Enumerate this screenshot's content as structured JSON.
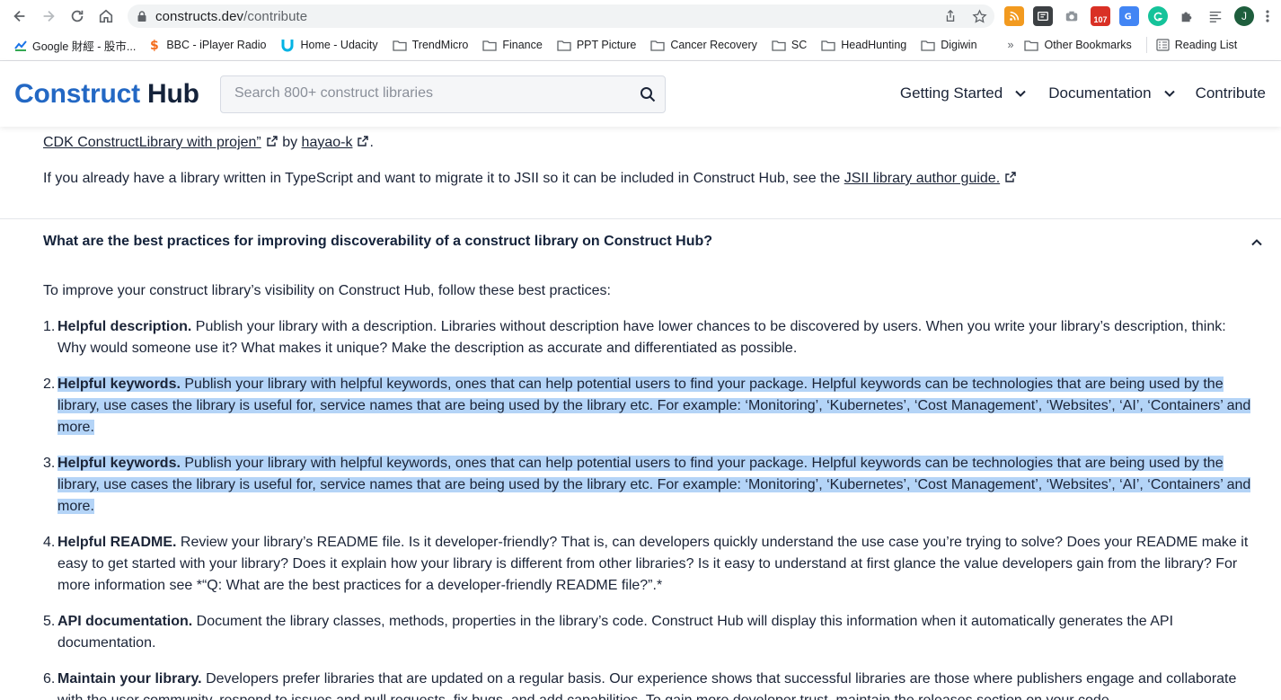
{
  "browser": {
    "url_host": "constructs.dev",
    "url_path": "/contribute",
    "ext_badge": "107",
    "avatar_letter": "J",
    "bookmarks": [
      {
        "label": "Google 財經 - 股市...",
        "icon": "google-finance-icon"
      },
      {
        "label": "BBC - iPlayer Radio",
        "icon": "bbc-icon"
      },
      {
        "label": "Home - Udacity",
        "icon": "udacity-icon"
      },
      {
        "label": "TrendMicro",
        "icon": "folder-icon"
      },
      {
        "label": "Finance",
        "icon": "folder-icon"
      },
      {
        "label": "PPT Picture",
        "icon": "folder-icon"
      },
      {
        "label": "Cancer Recovery",
        "icon": "folder-icon"
      },
      {
        "label": "SC",
        "icon": "folder-icon"
      },
      {
        "label": "HeadHunting",
        "icon": "folder-icon"
      },
      {
        "label": "Digiwin",
        "icon": "folder-icon"
      }
    ],
    "overflow_label": "»",
    "other_bookmarks": "Other Bookmarks",
    "reading_list": "Reading List"
  },
  "header": {
    "logo_construct": "Construct",
    "logo_hub": "Hub",
    "search_placeholder": "Search 800+ construct libraries",
    "nav": {
      "getting_started": "Getting Started",
      "documentation": "Documentation",
      "contribute": "Contribute"
    }
  },
  "content": {
    "top_link_text": "CDK ConstructLibrary with projen”",
    "top_by": " by ",
    "top_author": "hayao-k",
    "migrate_text": "If you already have a library written in TypeScript and want to migrate it to JSII so it can be included in Construct Hub, see the ",
    "migrate_link": "JSII library author guide.",
    "faq_question": "What are the best practices for improving discoverability of a construct library on Construct Hub?",
    "intro": "To improve your construct library’s visibility on Construct Hub, follow these best practices:",
    "practices": [
      {
        "title": "Helpful description.",
        "body": " Publish your library with a description. Libraries without description have lower chances to be discovered by users. When you write your library’s description, think: Why would someone use it? What makes it unique? Make the description as accurate and differentiated as possible."
      },
      {
        "title": "Helpful keywords.",
        "body": " Publish your library with helpful keywords, ones that can help potential users to find your package. Helpful keywords can be technologies that are being used by the library, use cases the library is useful for, service names that are being used by the library etc. For example: ‘Monitoring’, ‘Kubernetes’, ‘Cost Management’, ‘Websites’, ‘AI’, ‘Containers’ and more."
      },
      {
        "title": "Helpful keywords.",
        "body": " Publish your library with helpful keywords, ones that can help potential users to find your package. Helpful keywords can be technologies that are being used by the library, use cases the library is useful for, service names that are being used by the library etc. For example: ‘Monitoring’, ‘Kubernetes’, ‘Cost Management’, ‘Websites’, ‘AI’, ‘Containers’ and more."
      },
      {
        "title": "Helpful README.",
        "body": " Review your library’s README file. Is it developer-friendly? That is, can developers quickly understand the use case you’re trying to solve? Does your README make it easy to get started with your library? Does it explain how your library is different from other libraries? Is it easy to understand at first glance the value developers gain from the library? For more information see *“Q: What are the best practices for a developer-friendly README file?”.*"
      },
      {
        "title": "API documentation.",
        "body": " Document the library classes, methods, properties in the library’s code. Construct Hub will display this information when it automatically generates the API documentation."
      },
      {
        "title": "Maintain your library.",
        "body": " Developers prefer libraries that are updated on a regular basis. Our experience shows that successful libraries are those where publishers engage and collaborate with the user community, respond to issues and pull requests, fix bugs, and add capabilities. To gain more developer trust, maintain the releases section on your code"
      }
    ]
  },
  "colors": {
    "brand_blue": "#2368c4",
    "text_dark": "#14223a",
    "selection": "#b4d4f7"
  }
}
